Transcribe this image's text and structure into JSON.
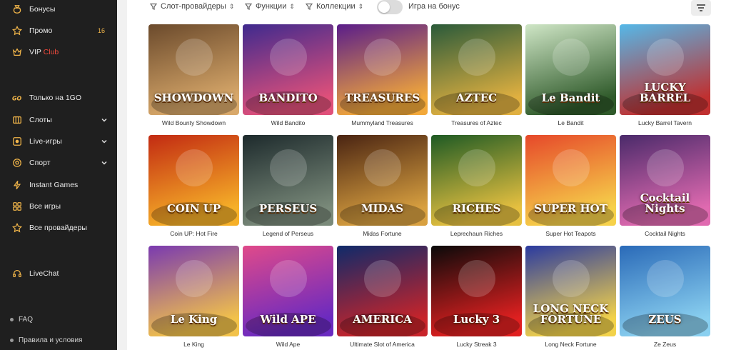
{
  "sidebar": {
    "items": [
      {
        "label": "Бонусы",
        "icon": "bonus-bag-icon"
      },
      {
        "label": "Промо",
        "icon": "star-icon",
        "count": "16"
      },
      {
        "label": "VIP",
        "extra": "Club",
        "icon": "crown-icon"
      },
      {
        "label": "Только на 1GO",
        "icon": "go-icon"
      },
      {
        "label": "Слоты",
        "icon": "slot-icon",
        "expandable": true
      },
      {
        "label": "Live-игры",
        "icon": "live-icon",
        "expandable": true
      },
      {
        "label": "Спорт",
        "icon": "ball-icon",
        "expandable": true
      },
      {
        "label": "Instant Games",
        "icon": "lightning-icon"
      },
      {
        "label": "Все игры",
        "icon": "grid-icon"
      },
      {
        "label": "Все провайдеры",
        "icon": "star-outline-icon"
      },
      {
        "label": "LiveChat",
        "icon": "headset-icon"
      }
    ],
    "footer": [
      {
        "label": "FAQ"
      },
      {
        "label": "Правила и условия"
      }
    ]
  },
  "filters": {
    "providers": "Слот-провайдеры",
    "features": "Функции",
    "collections": "Коллекции",
    "bonus_toggle_label": "Игра на бонус",
    "bonus_toggle_on": false
  },
  "colors": {
    "sidebar_bg": "#1f1f1f",
    "accent_red": "#f04a3c",
    "count_gold": "#f2b64a"
  },
  "games": [
    {
      "name": "Wild Bounty Showdown",
      "logo": "SHOWDOWN",
      "colors": [
        "#6b4a2c",
        "#d8a86a"
      ]
    },
    {
      "name": "Wild Bandito",
      "logo": "BANDITO",
      "colors": [
        "#3f2a8e",
        "#e0507a"
      ]
    },
    {
      "name": "Mummyland Treasures",
      "logo": "TREASURES",
      "colors": [
        "#5a1d8a",
        "#f2a83a"
      ]
    },
    {
      "name": "Treasures of Aztec",
      "logo": "AZTEC",
      "colors": [
        "#2a5a3a",
        "#e0b040"
      ]
    },
    {
      "name": "Le Bandit",
      "logo": "Le Bandit",
      "colors": [
        "#cfe6c6",
        "#2f5a2a"
      ]
    },
    {
      "name": "Lucky Barrel Tavern",
      "logo": "LUCKY BARREL",
      "colors": [
        "#55b8e8",
        "#c03030"
      ]
    },
    {
      "name": "Coin UP: Hot Fire",
      "logo": "COIN UP",
      "colors": [
        "#c22a12",
        "#f6b028"
      ]
    },
    {
      "name": "Legend of Perseus",
      "logo": "PERSEUS",
      "colors": [
        "#1d2a2c",
        "#7a8a7a"
      ]
    },
    {
      "name": "Midas Fortune",
      "logo": "MIDAS",
      "colors": [
        "#4a2412",
        "#d8a040"
      ]
    },
    {
      "name": "Leprechaun Riches",
      "logo": "RICHES",
      "colors": [
        "#1e5a24",
        "#e6c040"
      ]
    },
    {
      "name": "Super Hot Teapots",
      "logo": "SUPER HOT",
      "colors": [
        "#e6482a",
        "#f6d14a"
      ]
    },
    {
      "name": "Cocktail Nights",
      "logo": "Cocktail Nights",
      "colors": [
        "#4a2a6a",
        "#e06ab0"
      ]
    },
    {
      "name": "Le King",
      "logo": "Le King",
      "colors": [
        "#7a3ab0",
        "#f2c24a"
      ]
    },
    {
      "name": "Wild Ape",
      "logo": "Wild APE",
      "colors": [
        "#e04a8a",
        "#6a2ac0"
      ]
    },
    {
      "name": "Ultimate Slot of America",
      "logo": "AMERICA",
      "colors": [
        "#0f2a6a",
        "#c8242a"
      ]
    },
    {
      "name": "Lucky Streak 3",
      "logo": "Lucky 3",
      "colors": [
        "#0a0a0a",
        "#e02020"
      ]
    },
    {
      "name": "Long Neck Fortune",
      "logo": "LONG NECK FORTUNE",
      "colors": [
        "#2a3aa0",
        "#f2d24a"
      ]
    },
    {
      "name": "Ze Zeus",
      "logo": "ZEUS",
      "colors": [
        "#2a6ab8",
        "#8ad0f0"
      ]
    }
  ]
}
